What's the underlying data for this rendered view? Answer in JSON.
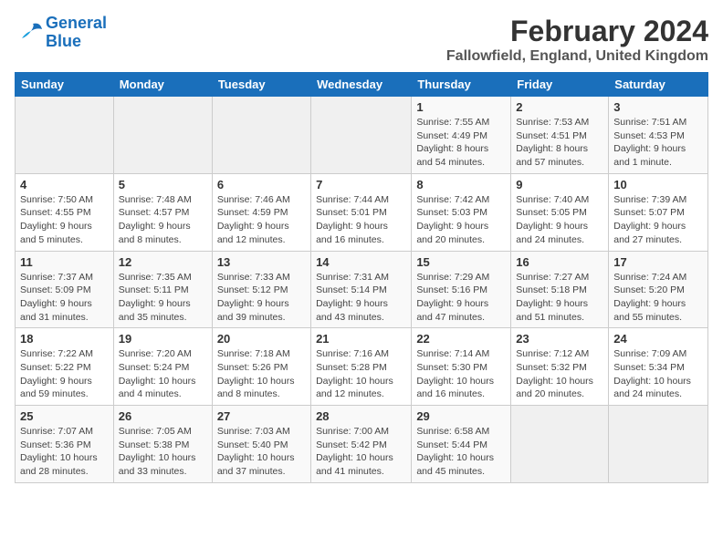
{
  "header": {
    "logo_line1": "General",
    "logo_line2": "Blue",
    "title": "February 2024",
    "subtitle": "Fallowfield, England, United Kingdom"
  },
  "weekdays": [
    "Sunday",
    "Monday",
    "Tuesday",
    "Wednesday",
    "Thursday",
    "Friday",
    "Saturday"
  ],
  "weeks": [
    [
      {
        "day": "",
        "info": ""
      },
      {
        "day": "",
        "info": ""
      },
      {
        "day": "",
        "info": ""
      },
      {
        "day": "",
        "info": ""
      },
      {
        "day": "1",
        "info": "Sunrise: 7:55 AM\nSunset: 4:49 PM\nDaylight: 8 hours\nand 54 minutes."
      },
      {
        "day": "2",
        "info": "Sunrise: 7:53 AM\nSunset: 4:51 PM\nDaylight: 8 hours\nand 57 minutes."
      },
      {
        "day": "3",
        "info": "Sunrise: 7:51 AM\nSunset: 4:53 PM\nDaylight: 9 hours\nand 1 minute."
      }
    ],
    [
      {
        "day": "4",
        "info": "Sunrise: 7:50 AM\nSunset: 4:55 PM\nDaylight: 9 hours\nand 5 minutes."
      },
      {
        "day": "5",
        "info": "Sunrise: 7:48 AM\nSunset: 4:57 PM\nDaylight: 9 hours\nand 8 minutes."
      },
      {
        "day": "6",
        "info": "Sunrise: 7:46 AM\nSunset: 4:59 PM\nDaylight: 9 hours\nand 12 minutes."
      },
      {
        "day": "7",
        "info": "Sunrise: 7:44 AM\nSunset: 5:01 PM\nDaylight: 9 hours\nand 16 minutes."
      },
      {
        "day": "8",
        "info": "Sunrise: 7:42 AM\nSunset: 5:03 PM\nDaylight: 9 hours\nand 20 minutes."
      },
      {
        "day": "9",
        "info": "Sunrise: 7:40 AM\nSunset: 5:05 PM\nDaylight: 9 hours\nand 24 minutes."
      },
      {
        "day": "10",
        "info": "Sunrise: 7:39 AM\nSunset: 5:07 PM\nDaylight: 9 hours\nand 27 minutes."
      }
    ],
    [
      {
        "day": "11",
        "info": "Sunrise: 7:37 AM\nSunset: 5:09 PM\nDaylight: 9 hours\nand 31 minutes."
      },
      {
        "day": "12",
        "info": "Sunrise: 7:35 AM\nSunset: 5:11 PM\nDaylight: 9 hours\nand 35 minutes."
      },
      {
        "day": "13",
        "info": "Sunrise: 7:33 AM\nSunset: 5:12 PM\nDaylight: 9 hours\nand 39 minutes."
      },
      {
        "day": "14",
        "info": "Sunrise: 7:31 AM\nSunset: 5:14 PM\nDaylight: 9 hours\nand 43 minutes."
      },
      {
        "day": "15",
        "info": "Sunrise: 7:29 AM\nSunset: 5:16 PM\nDaylight: 9 hours\nand 47 minutes."
      },
      {
        "day": "16",
        "info": "Sunrise: 7:27 AM\nSunset: 5:18 PM\nDaylight: 9 hours\nand 51 minutes."
      },
      {
        "day": "17",
        "info": "Sunrise: 7:24 AM\nSunset: 5:20 PM\nDaylight: 9 hours\nand 55 minutes."
      }
    ],
    [
      {
        "day": "18",
        "info": "Sunrise: 7:22 AM\nSunset: 5:22 PM\nDaylight: 9 hours\nand 59 minutes."
      },
      {
        "day": "19",
        "info": "Sunrise: 7:20 AM\nSunset: 5:24 PM\nDaylight: 10 hours\nand 4 minutes."
      },
      {
        "day": "20",
        "info": "Sunrise: 7:18 AM\nSunset: 5:26 PM\nDaylight: 10 hours\nand 8 minutes."
      },
      {
        "day": "21",
        "info": "Sunrise: 7:16 AM\nSunset: 5:28 PM\nDaylight: 10 hours\nand 12 minutes."
      },
      {
        "day": "22",
        "info": "Sunrise: 7:14 AM\nSunset: 5:30 PM\nDaylight: 10 hours\nand 16 minutes."
      },
      {
        "day": "23",
        "info": "Sunrise: 7:12 AM\nSunset: 5:32 PM\nDaylight: 10 hours\nand 20 minutes."
      },
      {
        "day": "24",
        "info": "Sunrise: 7:09 AM\nSunset: 5:34 PM\nDaylight: 10 hours\nand 24 minutes."
      }
    ],
    [
      {
        "day": "25",
        "info": "Sunrise: 7:07 AM\nSunset: 5:36 PM\nDaylight: 10 hours\nand 28 minutes."
      },
      {
        "day": "26",
        "info": "Sunrise: 7:05 AM\nSunset: 5:38 PM\nDaylight: 10 hours\nand 33 minutes."
      },
      {
        "day": "27",
        "info": "Sunrise: 7:03 AM\nSunset: 5:40 PM\nDaylight: 10 hours\nand 37 minutes."
      },
      {
        "day": "28",
        "info": "Sunrise: 7:00 AM\nSunset: 5:42 PM\nDaylight: 10 hours\nand 41 minutes."
      },
      {
        "day": "29",
        "info": "Sunrise: 6:58 AM\nSunset: 5:44 PM\nDaylight: 10 hours\nand 45 minutes."
      },
      {
        "day": "",
        "info": ""
      },
      {
        "day": "",
        "info": ""
      }
    ]
  ]
}
